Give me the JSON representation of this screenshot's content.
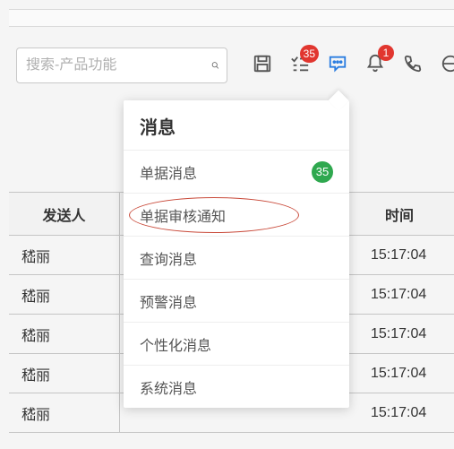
{
  "search": {
    "placeholder": "搜索-产品功能"
  },
  "toolbar": {
    "badges": {
      "chat": "35",
      "bell": "1"
    }
  },
  "table": {
    "headers": {
      "sender": "发送人",
      "time": "时间"
    },
    "rows": [
      {
        "sender": "嵇丽",
        "time": "15:17:04"
      },
      {
        "sender": "嵇丽",
        "time": "15:17:04"
      },
      {
        "sender": "嵇丽",
        "time": "15:17:04"
      },
      {
        "sender": "嵇丽",
        "time": "15:17:04"
      },
      {
        "sender": "嵇丽",
        "time": "15:17:04"
      }
    ]
  },
  "dropdown": {
    "title": "消息",
    "items": [
      {
        "label": "单据消息",
        "count": "35"
      },
      {
        "label": "单据审核通知",
        "circled": true
      },
      {
        "label": "查询消息"
      },
      {
        "label": "预警消息"
      },
      {
        "label": "个性化消息"
      },
      {
        "label": "系统消息"
      }
    ]
  }
}
